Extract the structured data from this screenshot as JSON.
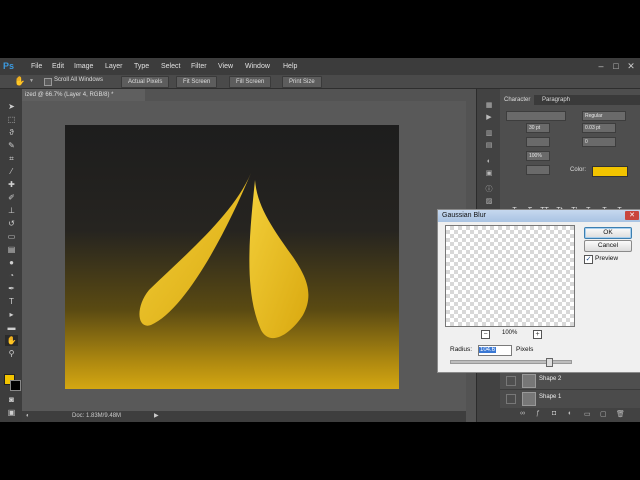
{
  "menubar": {
    "logo": "Ps",
    "items": [
      "File",
      "Edit",
      "Image",
      "Layer",
      "Type",
      "Select",
      "Filter",
      "View",
      "Window",
      "Help"
    ],
    "window_controls": [
      "–",
      "□",
      "✕"
    ]
  },
  "options": {
    "scroll_all_windows": "Scroll All Windows",
    "buttons": [
      "Actual Pixels",
      "Fit Screen",
      "Fill Screen",
      "Print Size"
    ]
  },
  "document": {
    "tab_title": "ized @ 66.7% (Layer 4, RGB/8) *",
    "status": "Doc: 1.83M/9.48M"
  },
  "character_panel": {
    "tabs": [
      "Character",
      "Paragraph"
    ],
    "font_style": "Regular",
    "color_label": "Color:",
    "color": "#f2c400",
    "size_field": "30 pt",
    "leading_field": "0.03 pt",
    "tracking_field": "0",
    "scale_v": "100%",
    "format_buttons": [
      "T",
      "T",
      "TT",
      "Tt",
      "T¹",
      "T₁",
      "T",
      "T"
    ]
  },
  "layers": {
    "items": [
      "Shape 2",
      "Shape 1"
    ]
  },
  "dialog": {
    "title": "Gaussian Blur",
    "ok": "OK",
    "cancel": "Cancel",
    "preview_label": "Preview",
    "preview_checked": true,
    "zoom": "100%",
    "radius_label": "Radius:",
    "radius_value": "104.6",
    "unit": "Pixels"
  },
  "colors": {
    "foreground": "#f2c400",
    "background": "#000000",
    "accent": "#e8b814"
  }
}
